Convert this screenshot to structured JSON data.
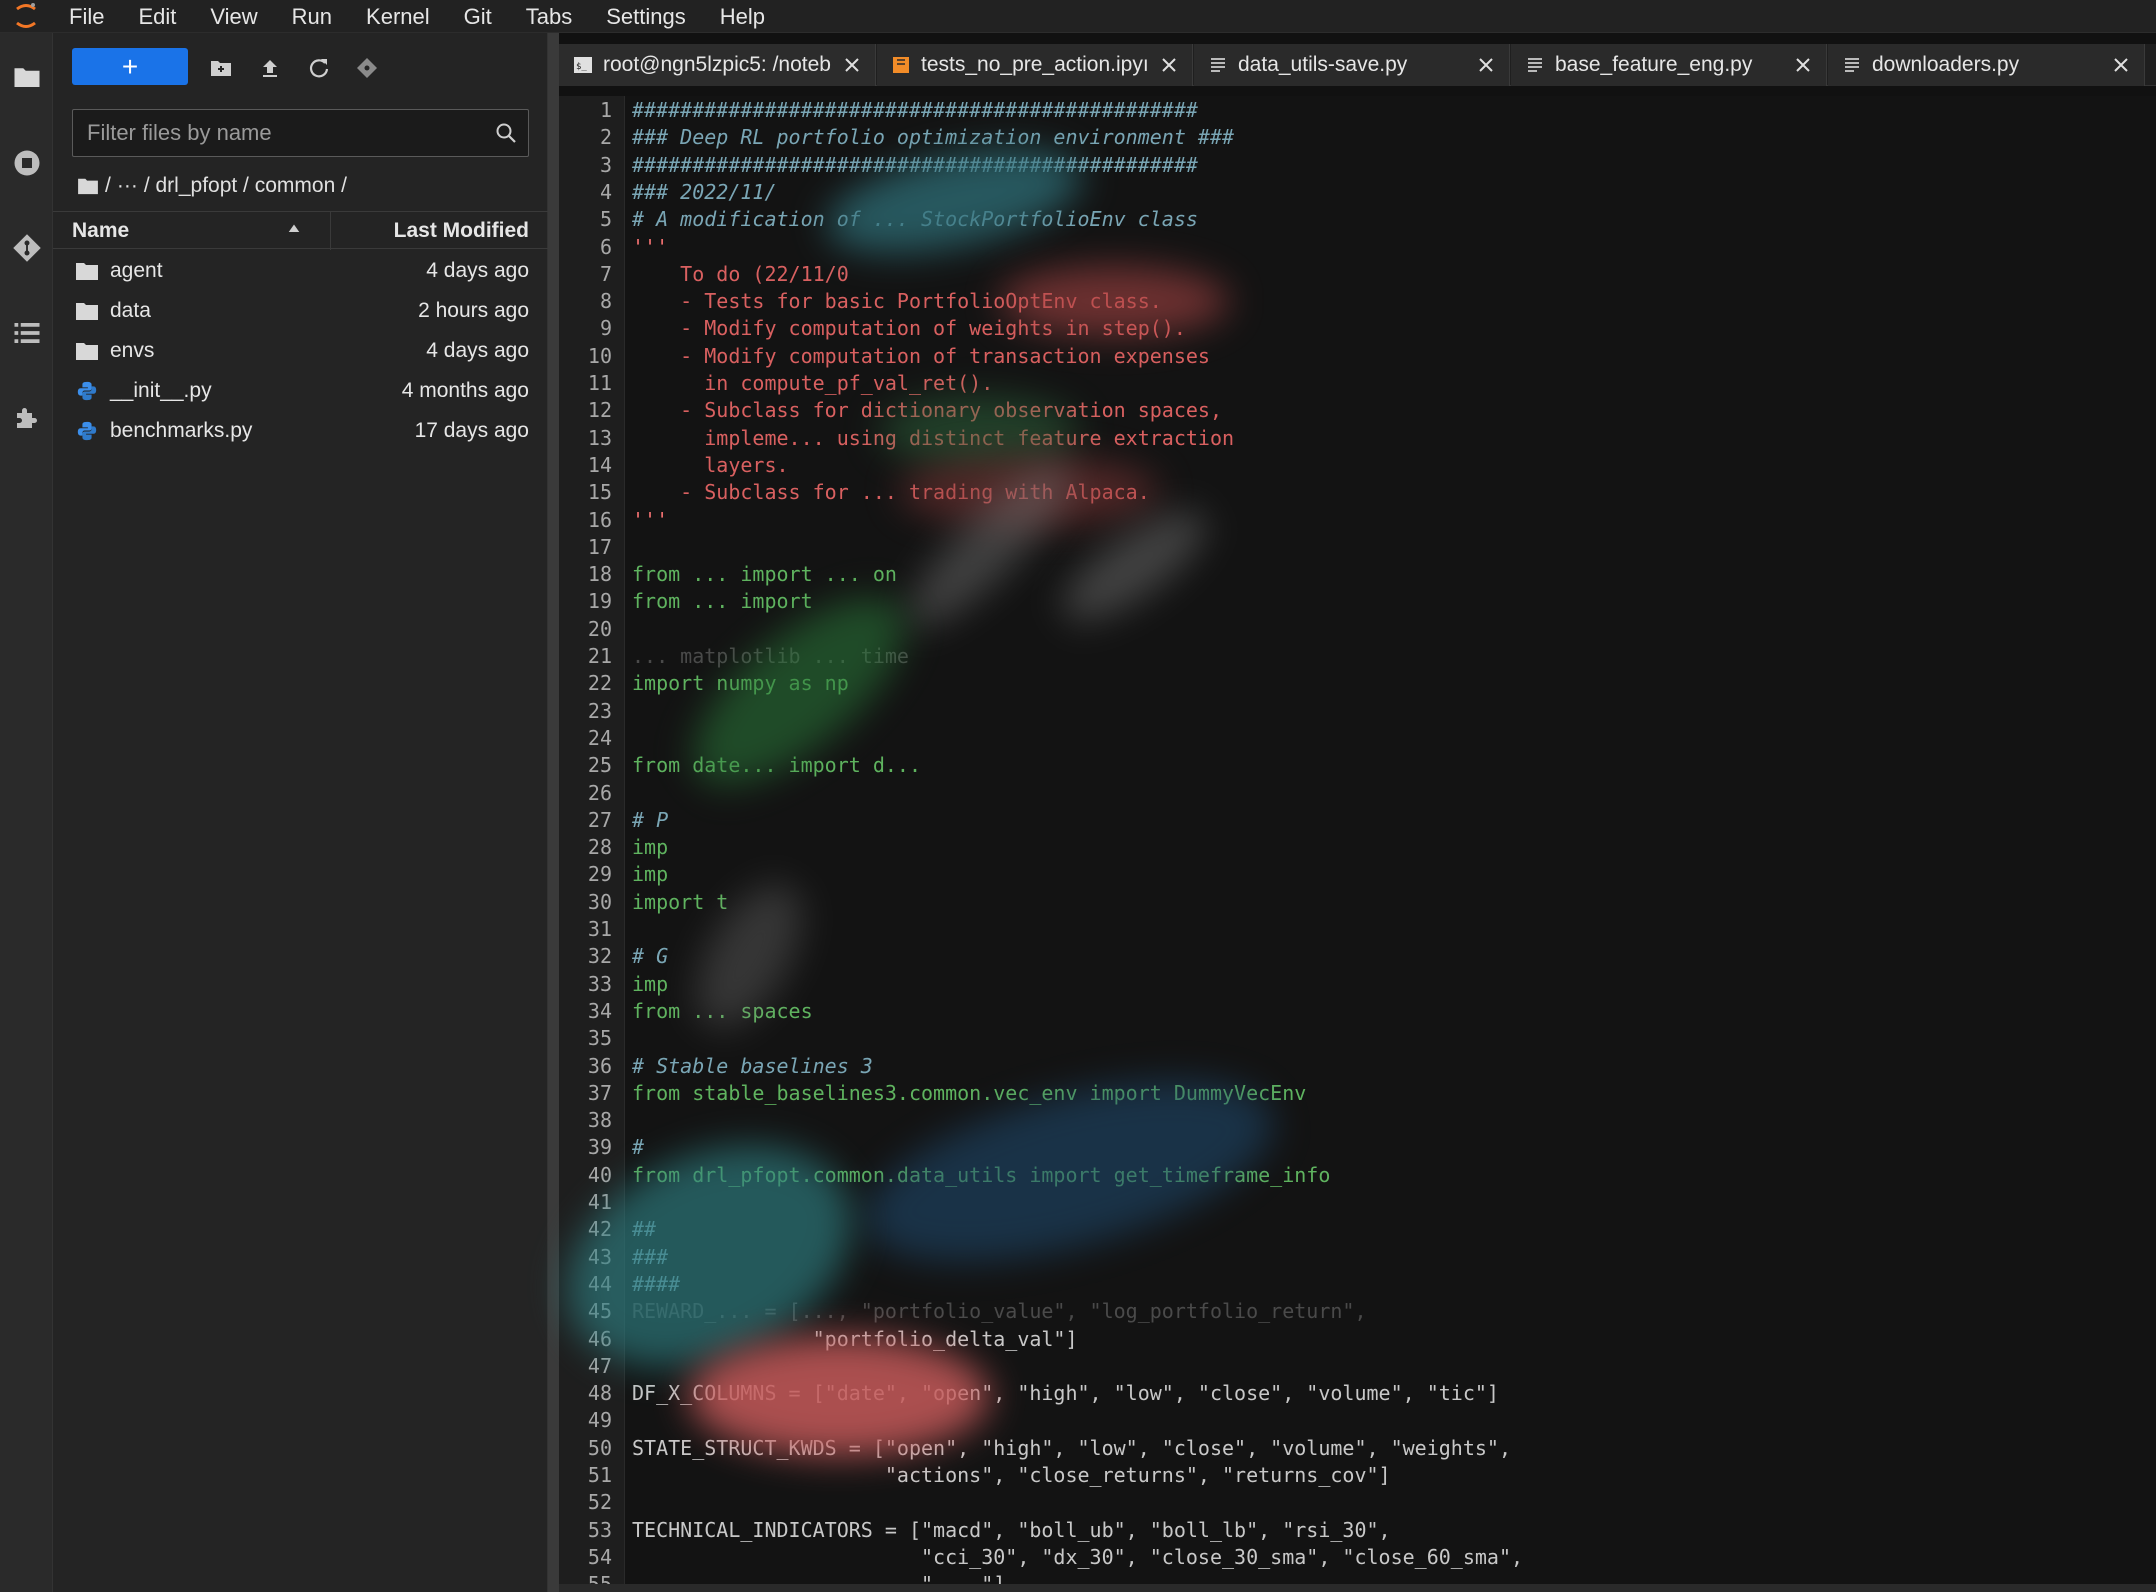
{
  "menu": [
    "File",
    "Edit",
    "View",
    "Run",
    "Kernel",
    "Git",
    "Tabs",
    "Settings",
    "Help"
  ],
  "colors": {
    "accent": "#1a73e8",
    "python": "#3b8eea",
    "notebook": "#f28c28"
  },
  "activity_bar": [
    "folder-icon",
    "running-icon",
    "git-icon",
    "toc-icon",
    "extension-icon"
  ],
  "file_browser": {
    "new_label": "+",
    "filter_placeholder": "Filter files by name",
    "breadcrumb": {
      "root": "/",
      "ellipsis": "···",
      "path": "/ drl_pfopt / common /"
    },
    "columns": {
      "name": "Name",
      "modified": "Last Modified"
    },
    "items": [
      {
        "name": "agent",
        "modified": "4 days ago",
        "type": "folder"
      },
      {
        "name": "data",
        "modified": "2 hours ago",
        "type": "folder"
      },
      {
        "name": "envs",
        "modified": "4 days ago",
        "type": "folder"
      },
      {
        "name": "__init__.py",
        "modified": "4 months ago",
        "type": "python"
      },
      {
        "name": "benchmarks.py",
        "modified": "17 days ago",
        "type": "python"
      }
    ]
  },
  "tabs": [
    {
      "label": "root@ngn5lzpic5: /noteb",
      "icon": "terminal-icon"
    },
    {
      "label": "tests_no_pre_action.ipyı",
      "icon": "notebook-icon"
    },
    {
      "label": "data_utils-save.py",
      "icon": "text-file-icon"
    },
    {
      "label": "base_feature_eng.py",
      "icon": "text-file-icon"
    },
    {
      "label": "downloaders.py",
      "icon": "text-file-icon"
    }
  ],
  "editor": {
    "line_count": 55,
    "lines": [
      "###############################################",
      "### Deep RL portfolio optimization environment ###",
      "###############################################",
      "### 2022/11/",
      "# A modification of ... StockPortfolioEnv class",
      "'''",
      "    To do (22/11/0",
      "    - Tests for basic PortfolioOptEnv class.",
      "    - Modify computation of weights in step().",
      "    - Modify computation of transaction expenses",
      "      in compute_pf_val_ret().",
      "    - Subclass for dictionary observation spaces,",
      "      impleme... using distinct feature extraction",
      "      layers.",
      "    - Subclass for ... trading with Alpaca.",
      "'''",
      "",
      "from ... import ... on",
      "from ... import",
      "",
      "... matplotlib ... time",
      "import numpy as np",
      "",
      "",
      "from date... import d...",
      "",
      "# P",
      "imp",
      "imp",
      "import t",
      "",
      "# G",
      "imp",
      "from ... spaces",
      "",
      "# Stable baselines 3",
      "from stable_baselines3.common.vec_env import DummyVecEnv",
      "",
      "#",
      "from drl_pfopt.common.data_utils import get_timeframe_info",
      "",
      "##",
      "###",
      "####",
      "REWARD_... = [..., \"portfolio_value\", \"log_portfolio_return\",",
      "               \"portfolio_delta_val\"]",
      "",
      "DF_X_COLUMNS = [\"date\", \"open\", \"high\", \"low\", \"close\", \"volume\", \"tic\"]",
      "",
      "STATE_STRUCT_KWDS = [\"open\", \"high\", \"low\", \"close\", \"volume\", \"weights\",",
      "                     \"actions\", \"close_returns\", \"returns_cov\"]",
      "",
      "TECHNICAL_INDICATORS = [\"macd\", \"boll_ub\", \"boll_lb\", \"rsi_30\",",
      "                        \"cci_30\", \"dx_30\", \"close_30_sma\", \"close_60_sma\",",
      "                        \"... \"]"
    ]
  }
}
